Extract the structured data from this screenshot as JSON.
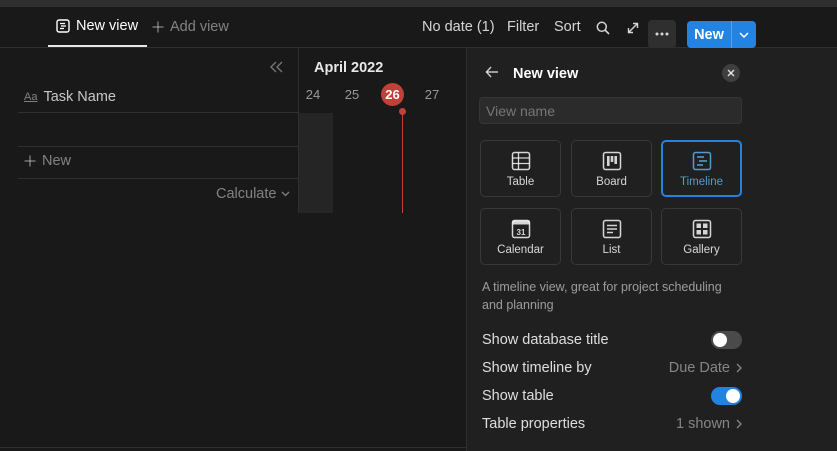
{
  "header": {
    "active_tab": "New view",
    "add_view": "Add view",
    "no_date": "No date (1)",
    "filter": "Filter",
    "sort": "Sort",
    "new_button": "New"
  },
  "table": {
    "column_name": "Task Name",
    "column_type_glyph": "Aa",
    "new_row": "New",
    "calculate": "Calculate"
  },
  "timeline": {
    "month": "April 2022",
    "days": [
      "24",
      "25",
      "26",
      "27"
    ],
    "today": "26"
  },
  "panel": {
    "title": "New view",
    "name_placeholder": "View name",
    "layouts": [
      {
        "label": "Table",
        "icon": "table-icon"
      },
      {
        "label": "Board",
        "icon": "board-icon"
      },
      {
        "label": "Timeline",
        "icon": "timeline-icon",
        "selected": true
      },
      {
        "label": "Calendar",
        "icon": "calendar-icon",
        "glyph": "31"
      },
      {
        "label": "List",
        "icon": "list-icon"
      },
      {
        "label": "Gallery",
        "icon": "gallery-icon"
      }
    ],
    "description": "A timeline view, great for project scheduling and planning",
    "settings": {
      "show_database_title": {
        "label": "Show database title",
        "on": false
      },
      "show_timeline_by": {
        "label": "Show timeline by",
        "value": "Due Date"
      },
      "show_table": {
        "label": "Show table",
        "on": true
      },
      "table_properties": {
        "label": "Table properties",
        "value": "1 shown"
      }
    }
  },
  "colors": {
    "accent": "#2383e2",
    "today": "#c0403a",
    "background": "#191919",
    "panel": "#202020"
  }
}
